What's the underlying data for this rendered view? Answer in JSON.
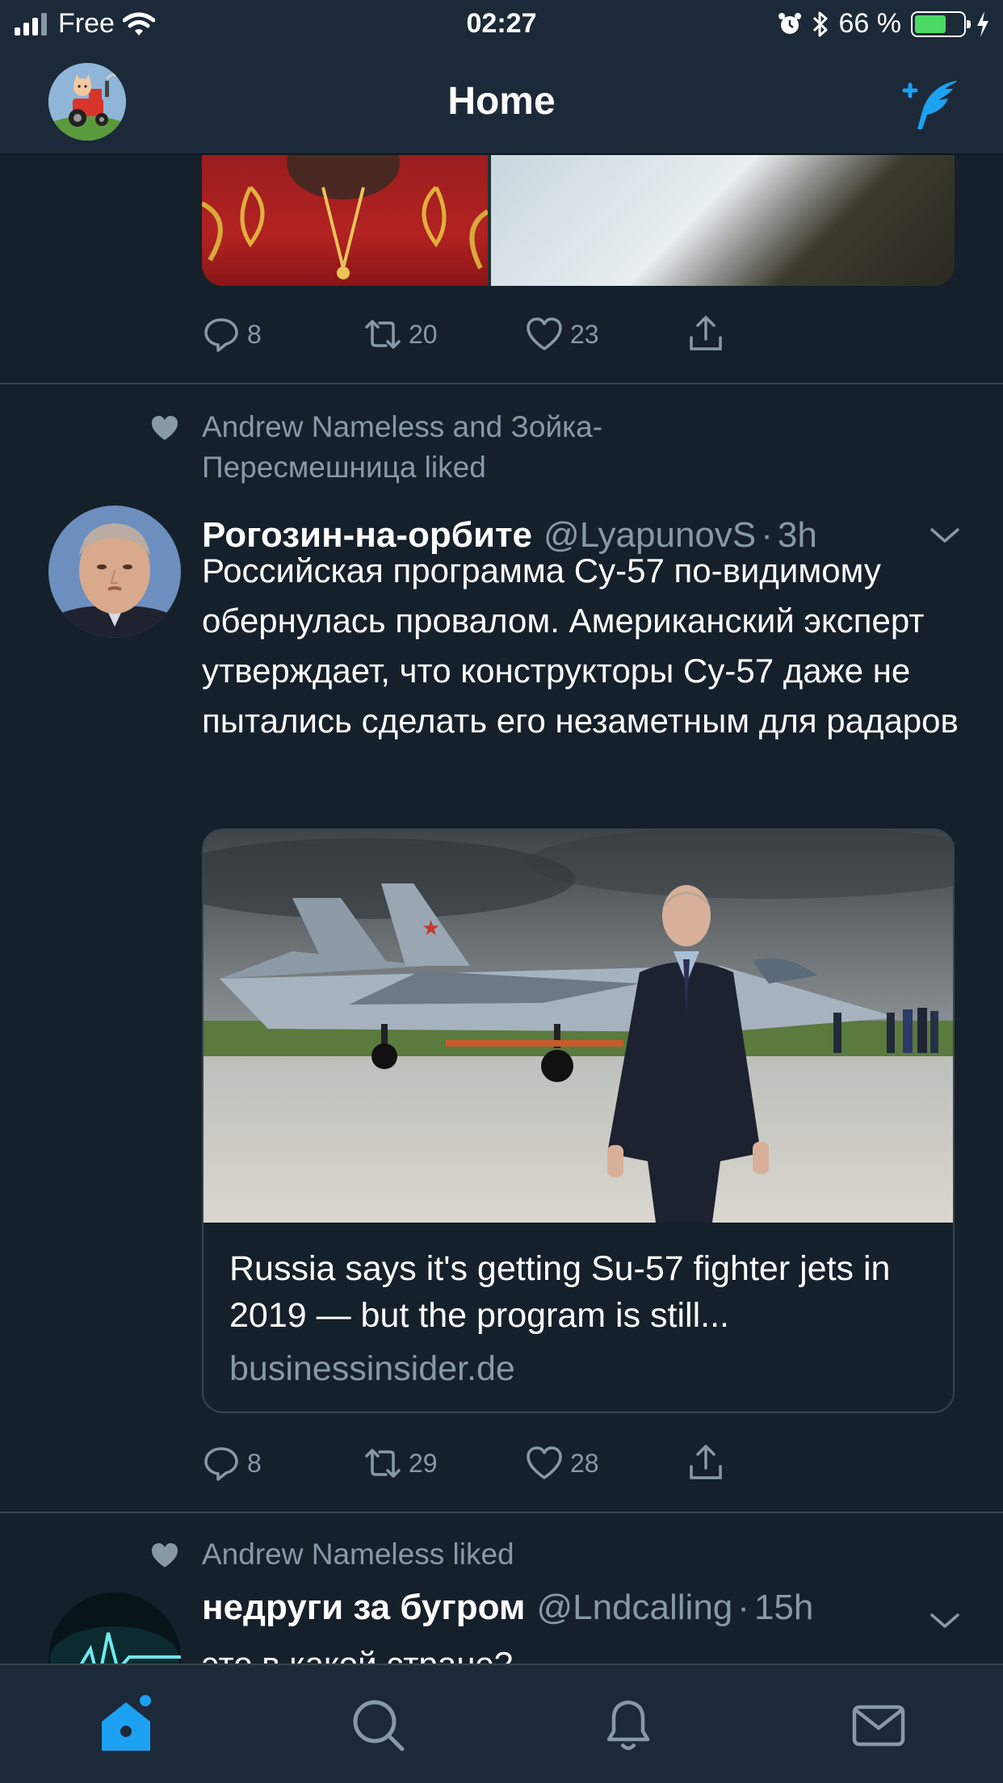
{
  "status_bar": {
    "carrier": "Free",
    "time": "02:27",
    "battery_percent": "66 %",
    "battery_level": 0.66,
    "colors": {
      "battery_fill": "#4cd964"
    }
  },
  "header": {
    "title": "Home",
    "avatar_icon": "tractor-cartoon-avatar",
    "compose_icon": "compose-tweet-icon",
    "accent_color": "#1da1f2"
  },
  "previous_tweet": {
    "actions": {
      "replies": "8",
      "retweets": "20",
      "likes": "23"
    }
  },
  "tweet1": {
    "social_context": "Andrew Nameless and Зойка-Пересмешница liked",
    "name": "Рогозин-на-орбите",
    "handle": "@LyapunovS",
    "separator": "·",
    "time": "3h",
    "text": "Российская программа Су-57 по-видимому обернулась провалом. Американский эксперт утверждает, что конструкторы Су-57 даже не пытались сделать его незаметным для радаров",
    "card": {
      "title": "Russia says it's getting Su-57 fighter jets in 2019 — but the program is still...",
      "domain": "businessinsider.de"
    },
    "actions": {
      "replies": "8",
      "retweets": "29",
      "likes": "28"
    }
  },
  "tweet2": {
    "social_context": "Andrew Nameless liked",
    "name": "недруги за бугром",
    "handle": "@Lndcalling",
    "separator": "·",
    "time": "15h",
    "text": "это в какой стране?"
  },
  "tab_bar": {
    "tabs": [
      "home-icon",
      "search-icon",
      "notifications-icon",
      "messages-icon"
    ],
    "active": "home-icon"
  },
  "colors": {
    "background": "#15202b",
    "bar_background": "#1c2938",
    "secondary_text": "#8899a6",
    "divider": "#38444d",
    "accent": "#1da1f2"
  }
}
